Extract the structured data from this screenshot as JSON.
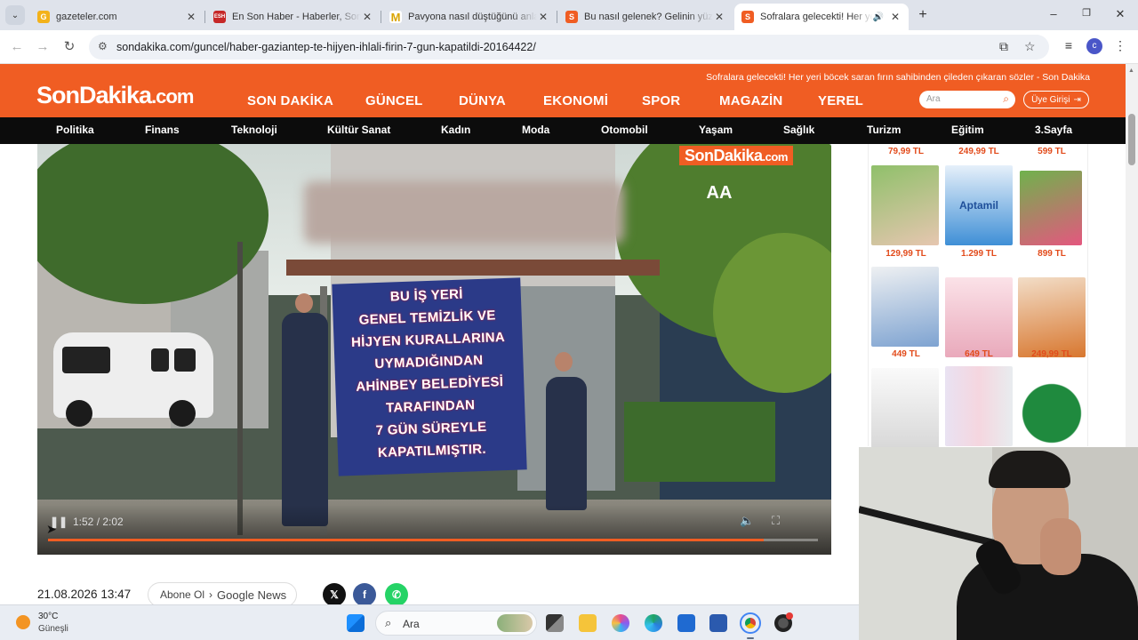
{
  "browser": {
    "tabs": [
      {
        "title": "gazeteler.com",
        "favicon": "G",
        "favicon_color": "#f3b21a",
        "active": false
      },
      {
        "title": "En Son Haber - Haberler, Son Dakika",
        "favicon": "ESH",
        "favicon_color": "#c62828",
        "active": false
      },
      {
        "title": "Pavyona nasıl düştüğünü anlatan",
        "favicon": "M",
        "favicon_color": "#d9a400",
        "active": false
      },
      {
        "title": "Bu nasıl gelenek? Gelinin yüz ifadesi",
        "favicon": "S",
        "favicon_color": "#f05d23",
        "active": false
      },
      {
        "title": "Sofralara gelecekti! Her yeri",
        "favicon": "S",
        "favicon_color": "#f05d23",
        "active": true
      }
    ],
    "url": "sondakika.com/guncel/haber-gaziantep-te-hijyen-ihlali-firin-7-gun-kapatildi-20164422/"
  },
  "site": {
    "logo_main": "SonDakika",
    "logo_tld": ".com",
    "ticker": "Sofralara gelecekti! Her yeri böcek saran fırın sahibinden çileden çıkaran sözler - Son Dakika",
    "main_nav": [
      "SON DAKİKA",
      "GÜNCEL",
      "DÜNYA",
      "EKONOMİ",
      "SPOR",
      "MAGAZİN",
      "YEREL"
    ],
    "search_placeholder": "Ara",
    "login_label": "Üye Girişi",
    "sub_nav": [
      "Politika",
      "Finans",
      "Teknoloji",
      "Kültür Sanat",
      "Kadın",
      "Moda",
      "Otomobil",
      "Yaşam",
      "Sağlık",
      "Turizm",
      "Eğitim",
      "3.Sayfa"
    ],
    "brand_color": "#f05d23"
  },
  "video": {
    "watermark": "SonDakika",
    "watermark_tld": ".com",
    "agency_logo": "AA",
    "banner_lines": [
      "BU İŞ YERİ",
      "GENEL TEMİZLİK VE",
      "HİJYEN KURALLARINA",
      "UYMADIĞINDAN",
      "AHİNBEY BELEDİYESİ",
      "TARAFINDAN",
      "7 GÜN SÜREYLE",
      "KAPATILMIŞTIR."
    ],
    "timecode": "1:52 / 2:02",
    "progress_fraction": 0.93
  },
  "article": {
    "date": "21.08.2026 13:47",
    "follow_label": "Abone Ol",
    "follow_service": "Google News"
  },
  "ads": {
    "row0_prices": [
      "79,99 TL",
      "249,99 TL",
      "599 TL"
    ],
    "row1_prices": [
      "129,99 TL",
      "1.299 TL",
      "899 TL"
    ],
    "row2_prices": [
      "449 TL",
      "649 TL",
      "249,99 TL"
    ],
    "brand_text": "Aptamil"
  },
  "taskbar": {
    "temperature": "30°C",
    "weather": "Güneşli",
    "search_placeholder": "Ara"
  }
}
